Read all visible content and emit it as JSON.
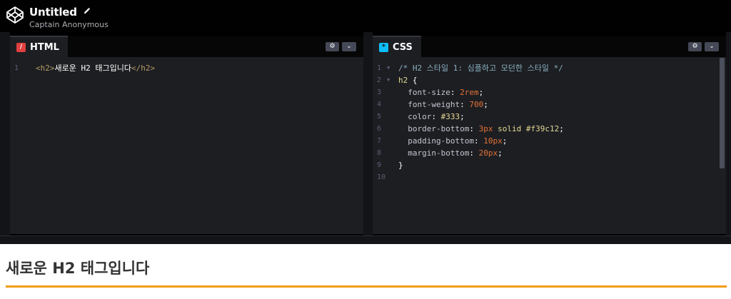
{
  "header": {
    "title": "Untitled",
    "author": "Captain Anonymous",
    "edit_icon": "pencil-icon",
    "logo_icon": "codepen-logo-icon"
  },
  "editors": {
    "html": {
      "tab_label": "HTML",
      "badge": "/",
      "lines": [
        {
          "n": "1",
          "parts": [
            {
              "t": "<h2>",
              "c": "c-tag"
            },
            {
              "t": "새로운 H2 태그입니다",
              "c": "c-plain"
            },
            {
              "t": "</h2>",
              "c": "c-tag"
            }
          ]
        }
      ]
    },
    "css": {
      "tab_label": "CSS",
      "badge": "*",
      "lines": [
        {
          "n": "1",
          "fold": true,
          "parts": [
            {
              "t": "/* H2 스타일 1: 심플하고 모던한 스타일 */",
              "c": "c-com"
            }
          ]
        },
        {
          "n": "2",
          "fold": true,
          "parts": [
            {
              "t": "h2",
              "c": "c-sel"
            },
            {
              "t": " {",
              "c": "c-plain"
            }
          ]
        },
        {
          "n": "3",
          "parts": [
            {
              "t": "  font-size",
              "c": "c-prop"
            },
            {
              "t": ": ",
              "c": "c-plain"
            },
            {
              "t": "2rem",
              "c": "c-num"
            },
            {
              "t": ";",
              "c": "c-plain"
            }
          ]
        },
        {
          "n": "4",
          "parts": [
            {
              "t": "  font-weight",
              "c": "c-prop"
            },
            {
              "t": ": ",
              "c": "c-plain"
            },
            {
              "t": "700",
              "c": "c-num"
            },
            {
              "t": ";",
              "c": "c-plain"
            }
          ]
        },
        {
          "n": "5",
          "parts": [
            {
              "t": "  color",
              "c": "c-prop"
            },
            {
              "t": ": ",
              "c": "c-plain"
            },
            {
              "t": "#333",
              "c": "c-hex"
            },
            {
              "t": ";",
              "c": "c-plain"
            }
          ]
        },
        {
          "n": "6",
          "parts": [
            {
              "t": "  border-bottom",
              "c": "c-prop"
            },
            {
              "t": ": ",
              "c": "c-plain"
            },
            {
              "t": "3px",
              "c": "c-num"
            },
            {
              "t": " ",
              "c": "c-plain"
            },
            {
              "t": "solid",
              "c": "c-kw"
            },
            {
              "t": " ",
              "c": "c-plain"
            },
            {
              "t": "#f39c12",
              "c": "c-hex"
            },
            {
              "t": ";",
              "c": "c-plain"
            }
          ]
        },
        {
          "n": "7",
          "parts": [
            {
              "t": "  padding-bottom",
              "c": "c-prop"
            },
            {
              "t": ": ",
              "c": "c-plain"
            },
            {
              "t": "10px",
              "c": "c-num"
            },
            {
              "t": ";",
              "c": "c-plain"
            }
          ]
        },
        {
          "n": "8",
          "parts": [
            {
              "t": "  margin-bottom",
              "c": "c-prop"
            },
            {
              "t": ": ",
              "c": "c-plain"
            },
            {
              "t": "20px",
              "c": "c-num"
            },
            {
              "t": ";",
              "c": "c-plain"
            }
          ]
        },
        {
          "n": "9",
          "parts": [
            {
              "t": "}",
              "c": "c-plain"
            }
          ]
        },
        {
          "n": "10",
          "parts": []
        }
      ]
    },
    "settings_icon": "gear-icon",
    "dropdown_icon": "chevron-down-icon"
  },
  "result": {
    "heading": "새로운 H2 태그입니다"
  },
  "colors": {
    "accent_border": "#f39c12",
    "heading_text": "#333333",
    "html_badge": "#e13f3f",
    "css_badge": "#0ebeff"
  }
}
